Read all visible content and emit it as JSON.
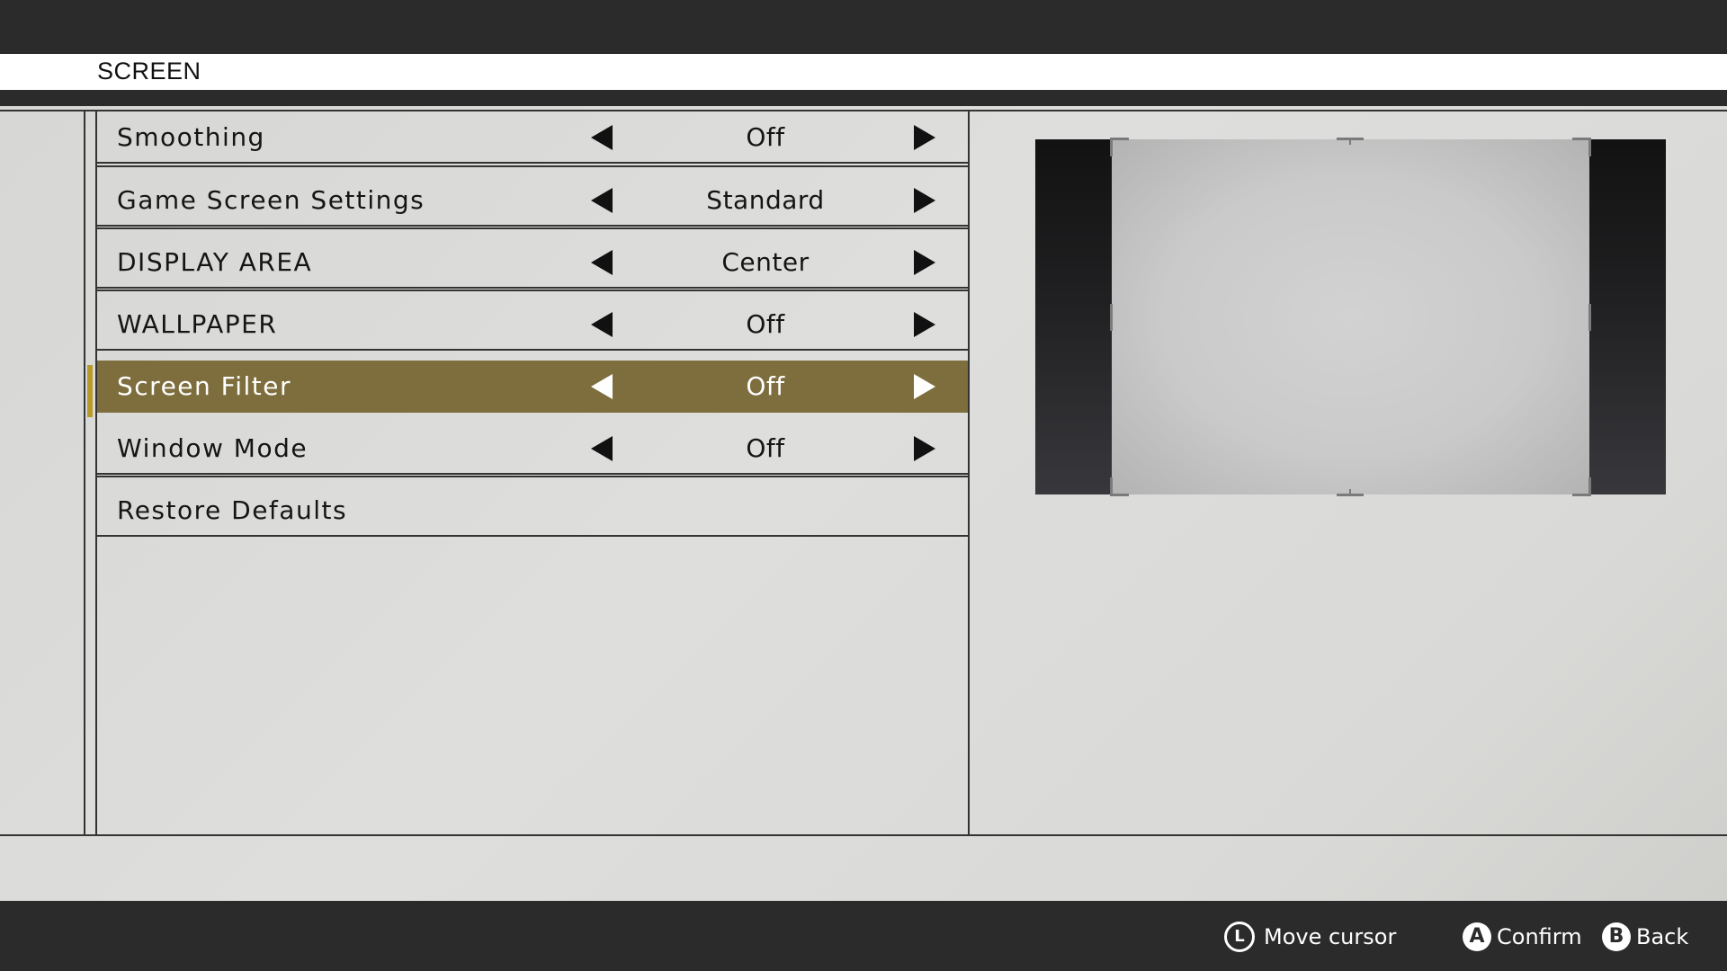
{
  "header": {
    "title": "SCREEN"
  },
  "menu": {
    "items": [
      {
        "label": "Smoothing",
        "value": "Off"
      },
      {
        "label": "Game Screen Settings",
        "value": "Standard"
      },
      {
        "label": "DISPLAY AREA",
        "value": "Center"
      },
      {
        "label": "WALLPAPER",
        "value": "Off"
      },
      {
        "label": "Screen Filter",
        "value": "Off",
        "selected": true
      },
      {
        "label": "Window Mode",
        "value": "Off"
      },
      {
        "label": "Restore Defaults"
      }
    ]
  },
  "footer": {
    "move": {
      "icon": "L",
      "label": "Move cursor"
    },
    "confirm": {
      "icon": "A",
      "label": "Confirm"
    },
    "back": {
      "icon": "B",
      "label": "Back"
    }
  },
  "colors": {
    "selected_row": "#7e6e3d",
    "cursor_marker": "#b89a2a",
    "bars": "#2b2b2b"
  }
}
